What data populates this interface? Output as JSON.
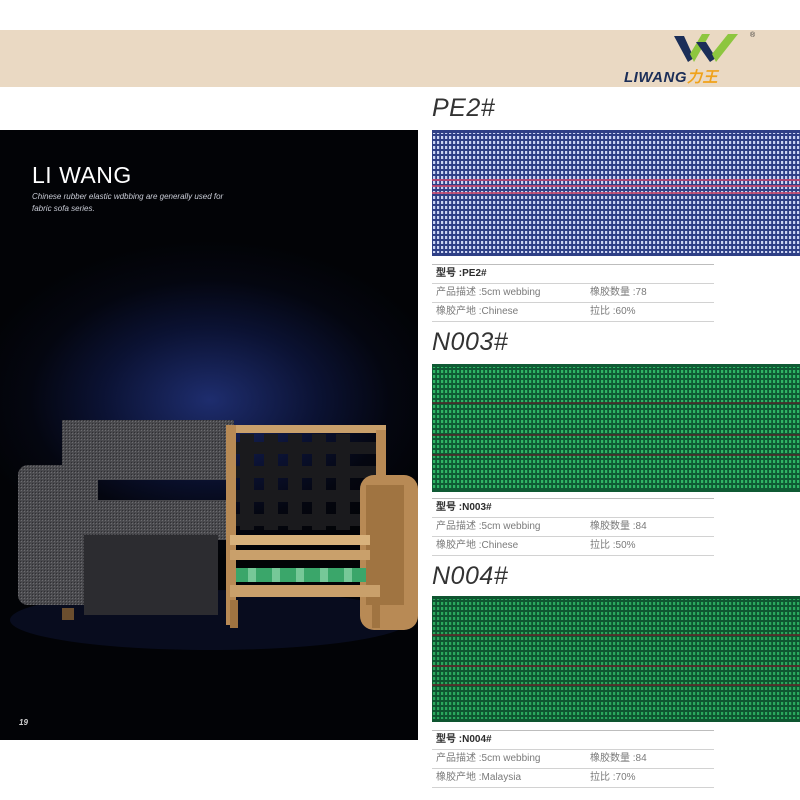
{
  "brand": {
    "name": "LIWANG",
    "chinese": "力王",
    "registered": "®"
  },
  "photo": {
    "title": "LI WANG",
    "caption": "Chinese rubber elastic wdbbing are generally used for fabric sofa series.",
    "page_number": "19"
  },
  "products": [
    {
      "title": "PE2#",
      "model": "型号 :PE2#",
      "description": "产品描述 :5cm webbing",
      "rubber_count": "橡胶数量 :78",
      "origin": "橡胶产地 :Chinese",
      "stretch": "拉比 :60%",
      "swatch_colors": {
        "base": "#2e3f86",
        "cell": "#c9d3f2",
        "stripe": "#c2456c"
      }
    },
    {
      "title": "N003#",
      "model": "型号 :N003#",
      "description": "产品描述 :5cm webbing",
      "rubber_count": "橡胶数量 :84",
      "origin": "橡胶产地 :Chinese",
      "stretch": "拉比 :50%",
      "swatch_colors": {
        "base": "#0f5a34",
        "cell": "#2fb565",
        "stripe": "#4a2a2a"
      }
    },
    {
      "title": "N004#",
      "model": "型号 :N004#",
      "description": "产品描述 :5cm webbing",
      "rubber_count": "橡胶数量 :84",
      "origin": "橡胶产地 :Malaysia",
      "stretch": "拉比 :70%",
      "swatch_colors": {
        "base": "#0e5530",
        "cell": "#2aa85d",
        "stripe": "#5a2a2a"
      }
    }
  ]
}
